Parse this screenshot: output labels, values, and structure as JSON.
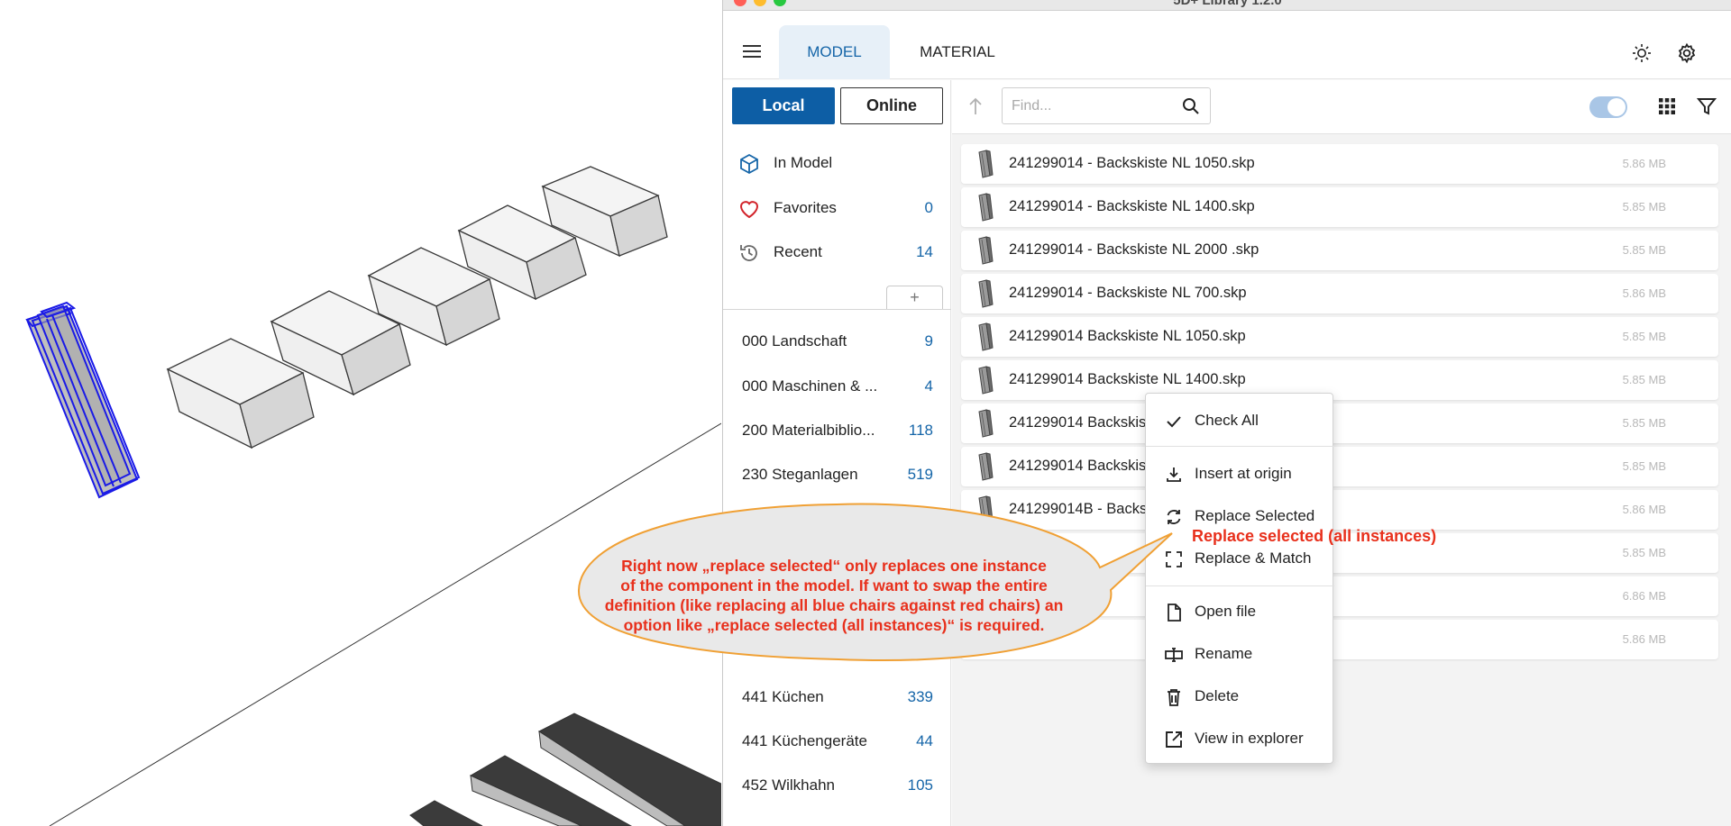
{
  "window": {
    "title": "5D+ Library 1.2.0"
  },
  "header": {
    "tabs": [
      {
        "label": "MODEL",
        "active": true
      },
      {
        "label": "MATERIAL",
        "active": false
      }
    ],
    "icons": [
      "menu-icon",
      "brightness-icon",
      "gear-icon"
    ]
  },
  "sidebar": {
    "source_buttons": {
      "local": "Local",
      "online": "Online"
    },
    "nav": [
      {
        "label": "In Model",
        "count": "",
        "icon": "cube-icon"
      },
      {
        "label": "Favorites",
        "count": "0",
        "icon": "heart-icon"
      },
      {
        "label": "Recent",
        "count": "14",
        "icon": "history-icon"
      }
    ],
    "add_label": "+",
    "folders": [
      {
        "label": "000 Landschaft",
        "count": "9"
      },
      {
        "label": "000 Maschinen & ...",
        "count": "4"
      },
      {
        "label": "200 Materialbiblio...",
        "count": "118"
      },
      {
        "label": "230 Steganlagen",
        "count": "519"
      },
      {
        "label": "441 Küchen",
        "count": "339"
      },
      {
        "label": "441 Küchengeräte",
        "count": "44"
      },
      {
        "label": "452 Wilkhahn",
        "count": "105"
      }
    ]
  },
  "toolbar": {
    "search_placeholder": "Find...",
    "toggle_on": true,
    "icons": [
      "arrow-up-icon",
      "search-icon",
      "grid-icon",
      "filter-icon"
    ]
  },
  "files": [
    {
      "name": "241299014 - Backskiste NL 1050.skp",
      "size": "5.86 MB"
    },
    {
      "name": "241299014 - Backskiste NL 1400.skp",
      "size": "5.85 MB"
    },
    {
      "name": "241299014 - Backskiste NL 2000 .skp",
      "size": "5.85 MB"
    },
    {
      "name": "241299014 - Backskiste NL 700.skp",
      "size": "5.86 MB"
    },
    {
      "name": "241299014 Backskiste NL 1050.skp",
      "size": "5.85 MB"
    },
    {
      "name": "241299014 Backskiste NL 1400.skp",
      "size": "5.85 MB"
    },
    {
      "name": "241299014 Backskis",
      "size": "5.85 MB"
    },
    {
      "name": "241299014 Backskis",
      "size": "5.85 MB"
    },
    {
      "name": "241299014B - Backs",
      "size": "5.86 MB"
    },
    {
      "name": "",
      "size": "5.85 MB"
    },
    {
      "name": "",
      "size": "6.86 MB"
    },
    {
      "name": "",
      "size": "5.86 MB"
    }
  ],
  "context_menu": {
    "items": [
      {
        "label": "Check All",
        "icon": "check-icon"
      },
      {
        "label": "Insert at origin",
        "icon": "insert-icon"
      },
      {
        "label": "Replace Selected",
        "icon": "replace-icon"
      },
      {
        "label": "Replace & Match",
        "icon": "expand-icon"
      },
      {
        "label": "Open file",
        "icon": "file-icon"
      },
      {
        "label": "Rename",
        "icon": "rename-icon"
      },
      {
        "label": "Delete",
        "icon": "trash-icon"
      },
      {
        "label": "View in explorer",
        "icon": "external-link-icon"
      }
    ]
  },
  "annotation": {
    "lines": [
      "Right now „replace selected“ only replaces one instance",
      "of the component in the model. If want to swap the entire",
      "definition (like replacing all blue chairs against red chairs) an",
      "option like „replace selected (all instances)“ is required."
    ],
    "suggestion": "Replace selected (all instances)",
    "color": "#e8301c"
  }
}
